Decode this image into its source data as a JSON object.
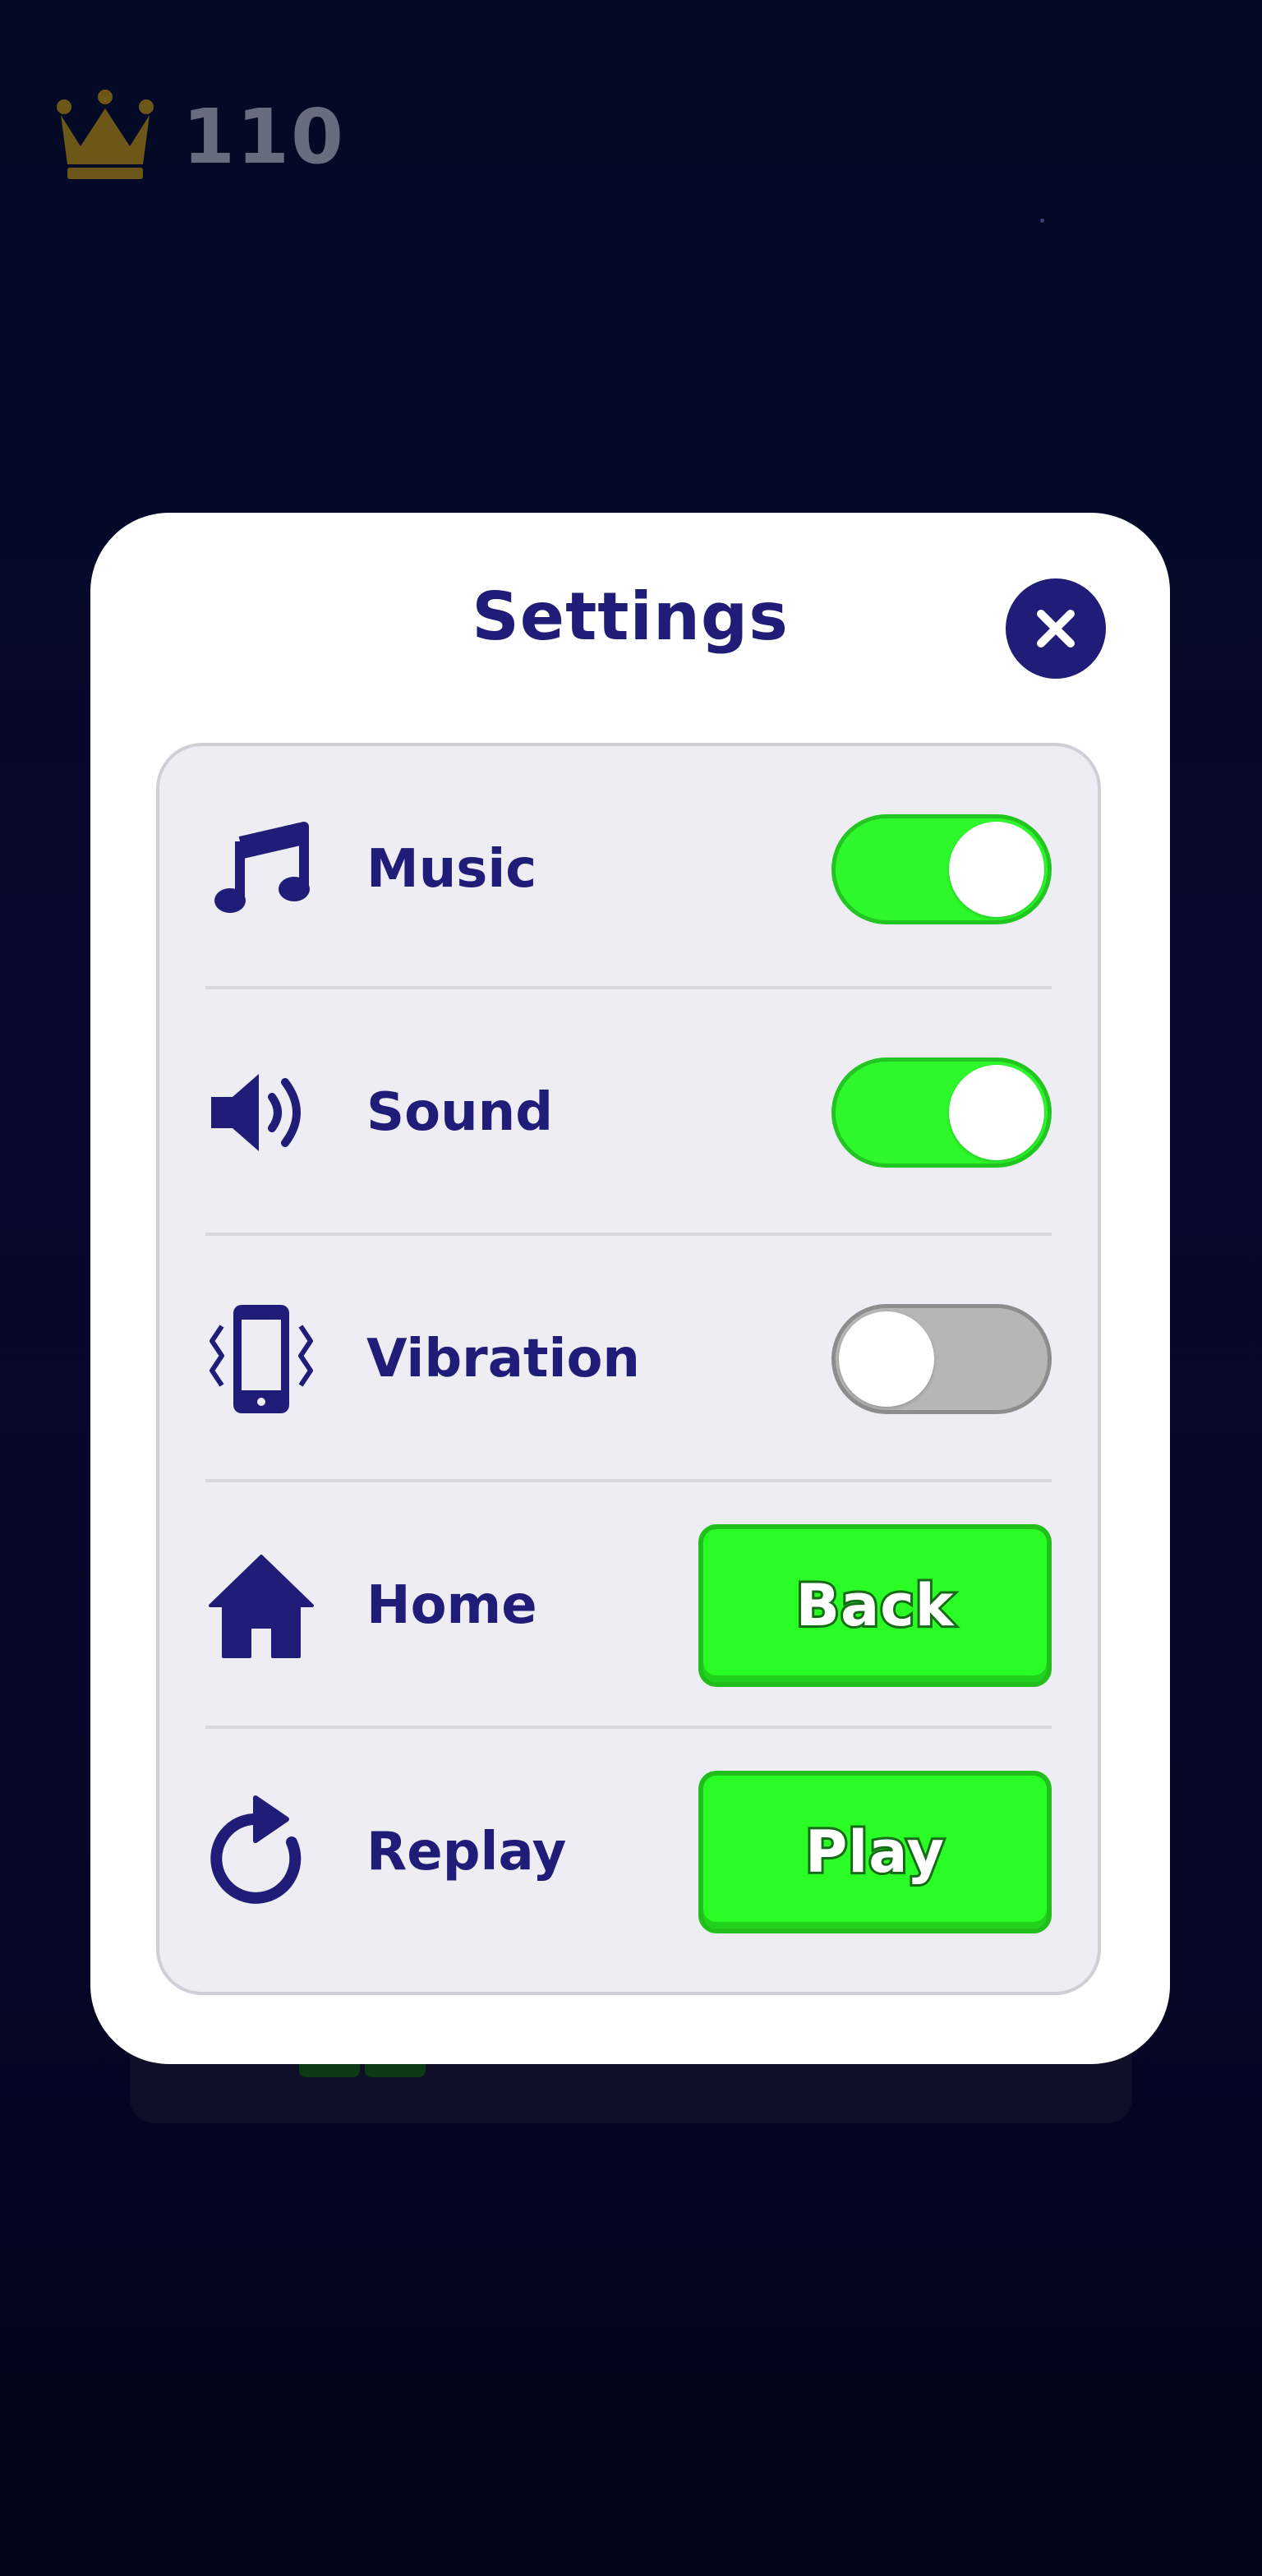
{
  "hud": {
    "score": "110",
    "crown_icon": "crown-icon",
    "crown_color": "#d4a20c"
  },
  "dialog": {
    "title": "Settings",
    "close_icon": "close-icon"
  },
  "settings": [
    {
      "id": "music",
      "label": "Music",
      "icon": "music-note-icon",
      "control": "toggle",
      "enabled": true
    },
    {
      "id": "sound",
      "label": "Sound",
      "icon": "speaker-icon",
      "control": "toggle",
      "enabled": true
    },
    {
      "id": "vibration",
      "label": "Vibration",
      "icon": "phone-vibrate-icon",
      "control": "toggle",
      "enabled": false
    },
    {
      "id": "home",
      "label": "Home",
      "icon": "home-icon",
      "control": "button",
      "button_label": "Back"
    },
    {
      "id": "replay",
      "label": "Replay",
      "icon": "replay-icon",
      "control": "button",
      "button_label": "Play"
    }
  ],
  "colors": {
    "primary": "#1f1d78",
    "toggle_on": "#2ef82c",
    "toggle_off": "#b6b6b6",
    "button_green": "#2afc25",
    "panel_bg": "#eeedf4"
  }
}
